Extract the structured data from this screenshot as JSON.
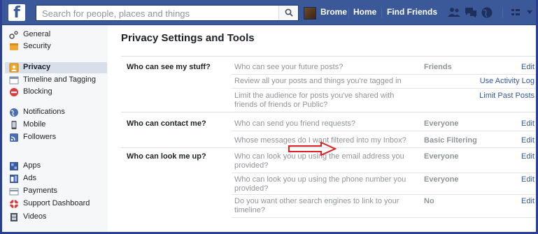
{
  "topbar": {
    "logo_letter": "f",
    "search_placeholder": "Search for people, places and things",
    "user_name": "Brome",
    "home_label": "Home",
    "find_friends_label": "Find Friends"
  },
  "sidebar": {
    "items": [
      {
        "label": "General",
        "icon": "gear-icon"
      },
      {
        "label": "Security",
        "icon": "shield-icon"
      },
      {
        "label": "Privacy",
        "icon": "lock-icon",
        "active": true
      },
      {
        "label": "Timeline and Tagging",
        "icon": "timeline-icon"
      },
      {
        "label": "Blocking",
        "icon": "block-icon"
      },
      {
        "label": "Notifications",
        "icon": "globe-icon"
      },
      {
        "label": "Mobile",
        "icon": "mobile-icon"
      },
      {
        "label": "Followers",
        "icon": "rss-icon"
      },
      {
        "label": "Apps",
        "icon": "apps-icon"
      },
      {
        "label": "Ads",
        "icon": "ads-icon"
      },
      {
        "label": "Payments",
        "icon": "card-icon"
      },
      {
        "label": "Support Dashboard",
        "icon": "lifebuoy-icon"
      },
      {
        "label": "Videos",
        "icon": "film-icon"
      }
    ]
  },
  "main": {
    "title": "Privacy Settings and Tools",
    "sections": [
      {
        "label": "Who can see my stuff?",
        "rows": [
          {
            "question": "Who can see your future posts?",
            "value": "Friends",
            "action": "Edit"
          },
          {
            "question": "Review all your posts and things you're tagged in",
            "value": "",
            "action": "Use Activity Log"
          },
          {
            "question": "Limit the audience for posts you've shared with friends of friends or Public?",
            "value": "",
            "action": "Limit Past Posts"
          }
        ]
      },
      {
        "label": "Who can contact me?",
        "rows": [
          {
            "question": "Who can send you friend requests?",
            "value": "Everyone",
            "action": "Edit"
          },
          {
            "question": "Whose messages do I want filtered into my Inbox?",
            "value": "Basic Filtering",
            "action": "Edit"
          }
        ]
      },
      {
        "label": "Who can look me up?",
        "rows": [
          {
            "question": "Who can look you up using the email address you provided?",
            "value": "Everyone",
            "action": "Edit"
          },
          {
            "question": "Who can look you up using the phone number you provided?",
            "value": "Everyone",
            "action": "Edit"
          },
          {
            "question": "Do you want other search engines to link to your timeline?",
            "value": "No",
            "action": "Edit"
          }
        ]
      }
    ]
  },
  "colors": {
    "brand": "#3b5998",
    "link": "#365899",
    "annotation": "#e02020",
    "frame": "#2a3f8f"
  }
}
